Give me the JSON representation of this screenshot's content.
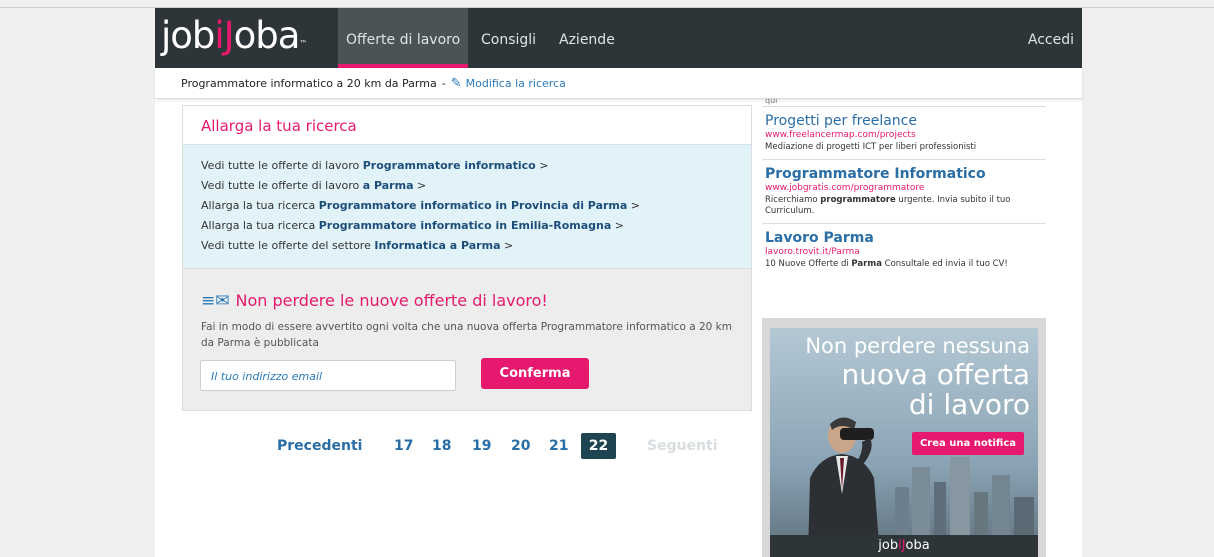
{
  "header": {
    "logo_left": "job",
    "logo_mid": "iJ",
    "logo_right": "oba",
    "logo_tm": "™",
    "nav": [
      "Offerte di lavoro",
      "Consigli",
      "Aziende"
    ],
    "active_nav": "Offerte di lavoro",
    "login": "Accedi"
  },
  "search_bar": {
    "query": "Programmatore informatico a 20 km da Parma",
    "separator": "-",
    "edit_icon": "pencil-icon",
    "edit_label": "Modifica la ricerca"
  },
  "broaden": {
    "title": "Allarga la tua ricerca",
    "rows": [
      {
        "prefix": "Vedi tutte le offerte di lavoro ",
        "bold": "Programmatore informatico",
        "suffix": " >"
      },
      {
        "prefix": "Vedi tutte le offerte di lavoro ",
        "bold": "a Parma",
        "suffix": " >"
      },
      {
        "prefix": "Allarga la tua ricerca ",
        "bold": "Programmatore informatico in Provincia di Parma",
        "suffix": " >"
      },
      {
        "prefix": "Allarga la tua ricerca ",
        "bold": "Programmatore informatico in Emilia-Romagna",
        "suffix": " >"
      },
      {
        "prefix": "Vedi tutte le offerte del settore ",
        "bold": "Informatica a Parma",
        "suffix": " >"
      }
    ]
  },
  "alert": {
    "icon": "envelope-icon",
    "title": "Non perdere le nuove offerte di lavoro!",
    "description": "Fai in modo di essere avvertito ogni volta che una nuova offerta Programmatore informatico a 20 km da Parma è pubblicata",
    "email_placeholder": "Il tuo indirizzo email",
    "confirm_label": "Conferma"
  },
  "pagination": {
    "prev": "Precedenti",
    "pages": [
      "17",
      "18",
      "19",
      "20",
      "21",
      "22"
    ],
    "current": "22",
    "next": "Seguenti"
  },
  "ads": [
    {
      "qui": "qui"
    },
    {
      "title": "Progetti per freelance",
      "url": "www.freelancermap.com/projects",
      "desc": "Mediazione di progetti ICT per liberi professionisti"
    },
    {
      "title": "Programmatore Informatico",
      "url": "www.jobgratis.com/programmatore",
      "desc_a": "Ricerchiamo ",
      "desc_b": "programmatore",
      "desc_c": " urgente. Invia subito il tuo Curriculum."
    },
    {
      "title": "Lavoro Parma",
      "url": "lavoro.trovit.it/Parma",
      "desc_a": "10 Nuove Offerte di ",
      "desc_b": "Parma",
      "desc_c": " Consultale ed invia il tuo CV!"
    }
  ],
  "banner": {
    "line1": "Non perdere nessuna",
    "line2": "nuova offerta",
    "line3": "di lavoro",
    "button": "Crea una notifica",
    "logo_left": "job",
    "logo_mid": "iJ",
    "logo_right": "oba"
  },
  "colors": {
    "brand_pink": "#e6196e",
    "header_dark": "#2e3538",
    "link_blue": "#2a6ea6",
    "light_blue_panel": "#e1f3f9"
  }
}
